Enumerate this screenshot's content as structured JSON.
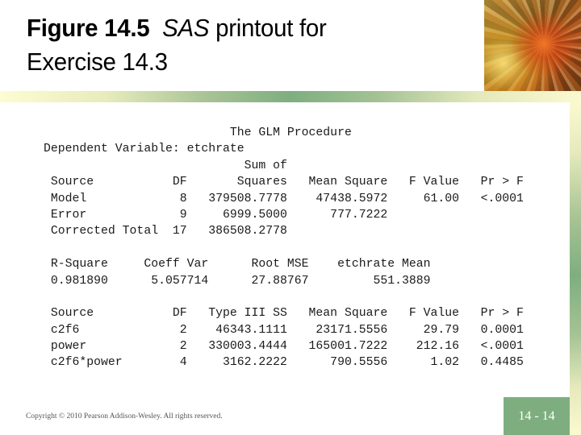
{
  "slide": {
    "title_bold": "Figure 14.5",
    "title_italic": "SAS",
    "title_rest_line1": " printout for",
    "title_line2": "Exercise 14.3",
    "copyright": "Copyright © 2010 Pearson Addison-Wesley. All rights reserved.",
    "page_number": "14 - 14",
    "colors": {
      "accent_green": "#7eae80",
      "pale_yellow": "#fdfcd2"
    }
  },
  "sas": {
    "procedure_title": "The GLM Procedure",
    "dependent_variable_label": "Dependent Variable:",
    "dependent_variable": "etchrate",
    "anova": {
      "header_top": [
        "",
        "",
        "Sum of",
        "",
        "",
        ""
      ],
      "headers": [
        "Source",
        "DF",
        "Squares",
        "Mean Square",
        "F Value",
        "Pr > F"
      ],
      "rows": [
        [
          "Model",
          "8",
          "379508.7778",
          "47438.5972",
          "61.00",
          "<.0001"
        ],
        [
          "Error",
          "9",
          "6999.5000",
          "777.7222",
          "",
          ""
        ],
        [
          "Corrected Total",
          "17",
          "386508.2778",
          "",
          "",
          ""
        ]
      ]
    },
    "fit": {
      "headers": [
        "R-Square",
        "Coeff Var",
        "Root MSE",
        "etchrate Mean"
      ],
      "values": [
        "0.981890",
        "5.057714",
        "27.88767",
        "551.3889"
      ]
    },
    "type3": {
      "headers": [
        "Source",
        "DF",
        "Type III SS",
        "Mean Square",
        "F Value",
        "Pr > F"
      ],
      "rows": [
        [
          "c2f6",
          "2",
          "46343.1111",
          "23171.5556",
          "29.79",
          "0.0001"
        ],
        [
          "power",
          "2",
          "330003.4444",
          "165001.7222",
          "212.16",
          "<.0001"
        ],
        [
          "c2f6*power",
          "4",
          "3162.2222",
          "790.5556",
          "1.02",
          "0.4485"
        ]
      ]
    }
  }
}
